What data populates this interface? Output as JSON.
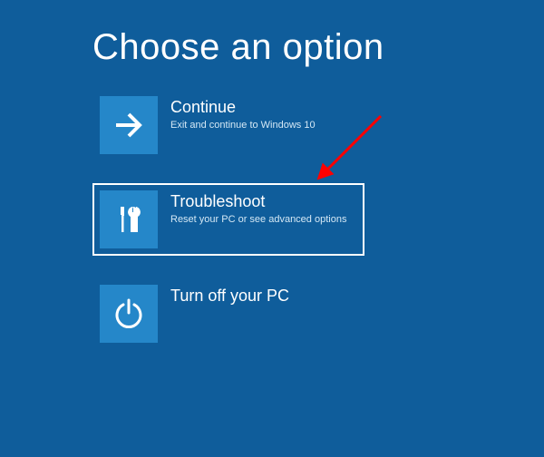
{
  "title": "Choose an option",
  "options": [
    {
      "title": "Continue",
      "subtitle": "Exit and continue to Windows 10",
      "selected": false
    },
    {
      "title": "Troubleshoot",
      "subtitle": "Reset your PC or see advanced options",
      "selected": true
    },
    {
      "title": "Turn off your PC",
      "subtitle": "",
      "selected": false
    }
  ],
  "colors": {
    "bg": "#0f5d9b",
    "tile": "#2587c9",
    "annotation": "#ff0000"
  }
}
